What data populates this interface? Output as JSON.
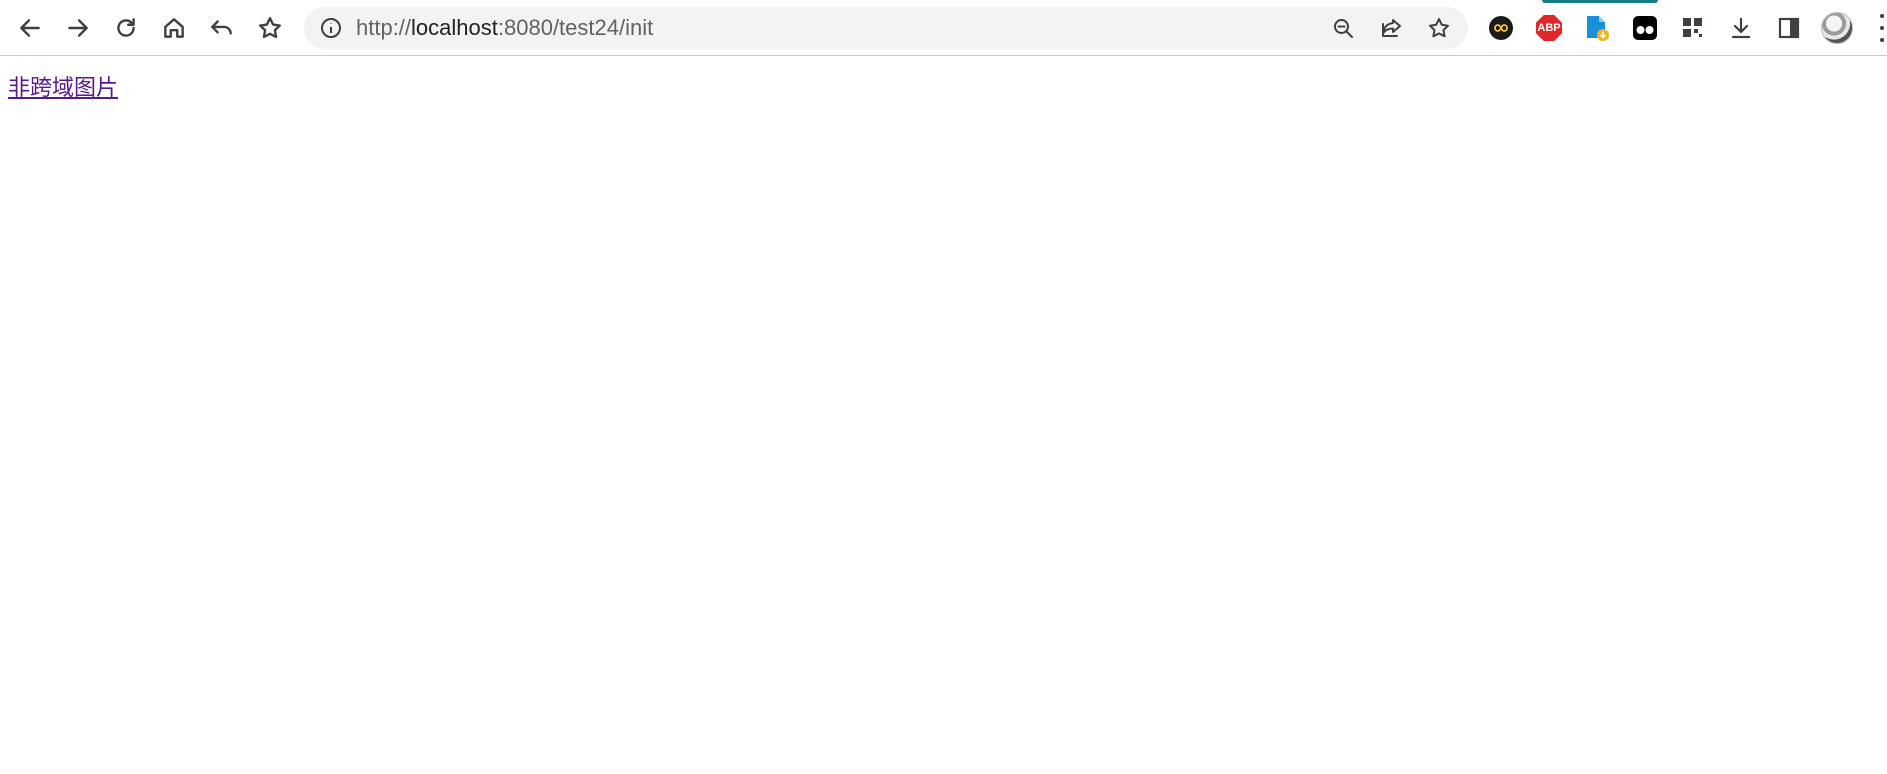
{
  "browser": {
    "toolbar_buttons": [
      {
        "name": "back",
        "icon": "arrow-left-icon"
      },
      {
        "name": "forward",
        "icon": "arrow-right-icon"
      },
      {
        "name": "reload",
        "icon": "reload-icon"
      },
      {
        "name": "home",
        "icon": "home-icon"
      },
      {
        "name": "undo",
        "icon": "undo-icon"
      },
      {
        "name": "bookmarks",
        "icon": "star-icon"
      }
    ],
    "address_bar": {
      "scheme": "http://",
      "host": "localhost",
      "rest": ":8080/test24/init",
      "info_icon": "info-icon",
      "actions": [
        "zoom-out-icon",
        "share-icon",
        "bookmark-star-icon"
      ]
    },
    "extensions": [
      {
        "name": "infinity-extension",
        "icon": "infinity-icon"
      },
      {
        "name": "adblock-plus",
        "icon": "abp-icon",
        "label": "ABP"
      },
      {
        "name": "file-download-extension",
        "icon": "file-download-icon"
      },
      {
        "name": "tampermonkey",
        "icon": "tampermonkey-icon"
      },
      {
        "name": "qr-extension",
        "icon": "grid-icon"
      },
      {
        "name": "downloads",
        "icon": "download-icon"
      },
      {
        "name": "side-panel",
        "icon": "side-panel-icon"
      }
    ],
    "accent_color": "#1b7a82"
  },
  "page": {
    "link_text": "非跨域图片",
    "link_color": "#551a8b"
  }
}
